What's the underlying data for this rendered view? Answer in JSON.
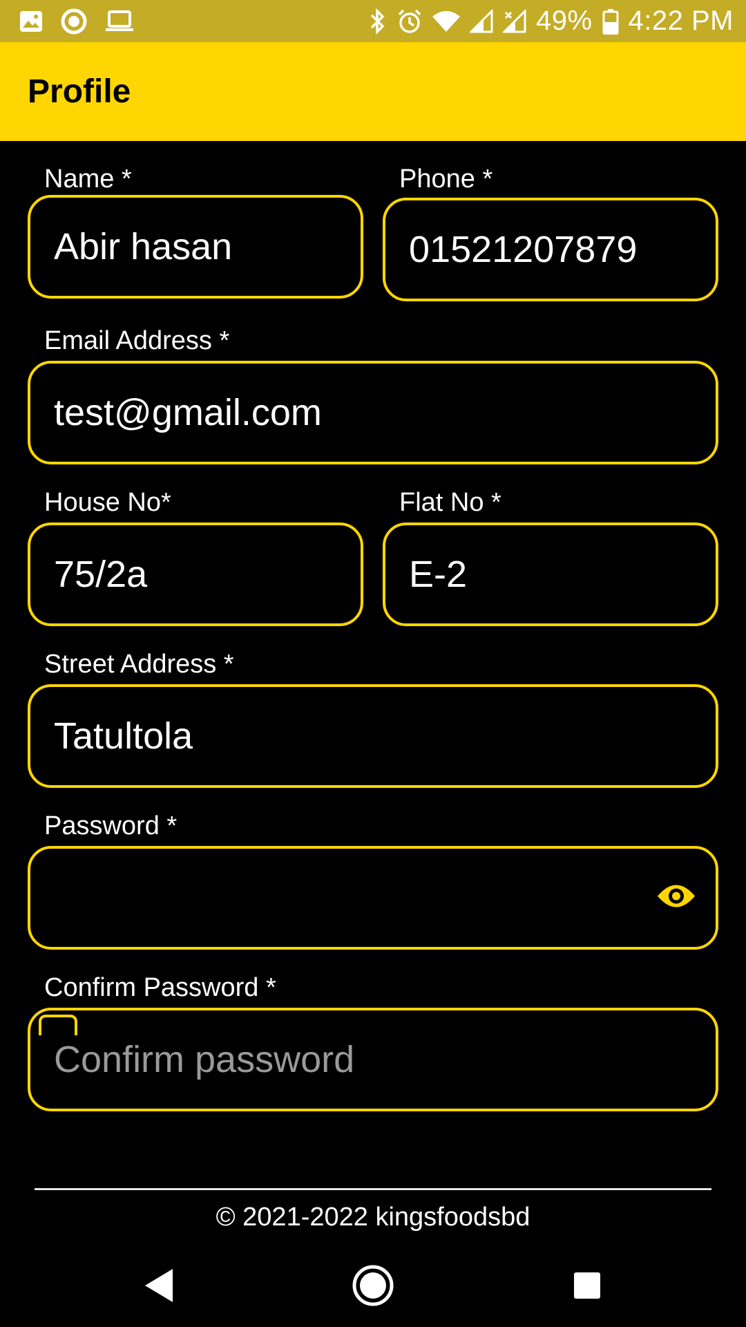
{
  "status_bar": {
    "battery": "49%",
    "time": "4:22 PM"
  },
  "app_bar": {
    "title": "Profile"
  },
  "form": {
    "name": {
      "label": "Name *",
      "value": "Abir hasan"
    },
    "phone": {
      "label": "Phone *",
      "value": "01521207879"
    },
    "email": {
      "label": "Email Address *",
      "value": "test@gmail.com"
    },
    "house": {
      "label": "House No*",
      "value": "75/2a"
    },
    "flat": {
      "label": "Flat No *",
      "value": "E-2"
    },
    "street": {
      "label": "Street Address *",
      "value": "Tatultola"
    },
    "password": {
      "label": "Password *",
      "value": ""
    },
    "confirm_password": {
      "label": "Confirm Password *",
      "placeholder": "Confirm password"
    }
  },
  "footer": {
    "copyright": "© 2021-2022 kingsfoodsbd"
  },
  "colors": {
    "accent": "#FFD600",
    "status_bar": "#C4AC26",
    "background": "#000000"
  },
  "icons": [
    "image-icon",
    "record-icon",
    "laptop-icon",
    "bluetooth-icon",
    "alarm-icon",
    "wifi-icon",
    "signal-icon",
    "signal-off-icon",
    "battery-icon",
    "eye-icon",
    "back-icon",
    "home-icon",
    "recents-icon"
  ]
}
